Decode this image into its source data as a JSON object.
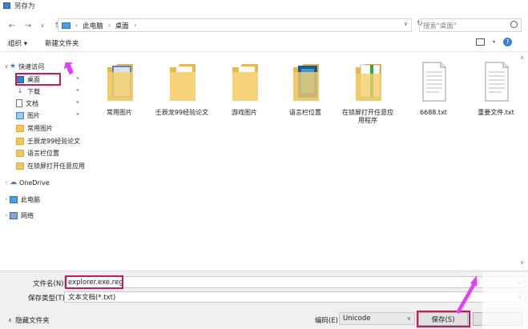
{
  "window": {
    "title": "另存为"
  },
  "nav": {
    "back": "←",
    "forward": "→",
    "up_arrow": "∨",
    "up": "↑"
  },
  "address": {
    "segments": [
      "此电脑",
      "桌面"
    ],
    "separator": "›",
    "dropdown": "∨",
    "refresh": "↻"
  },
  "search": {
    "placeholder": "搜索\"桌面\""
  },
  "toolbar": {
    "organize": "组织 ▾",
    "new_folder": "新建文件夹",
    "help": "?"
  },
  "sidebar": {
    "items": [
      {
        "label": "快速访问",
        "icon": "star-icon",
        "expander": "∨"
      },
      {
        "label": "桌面",
        "icon": "desktop-icon",
        "pinned": true
      },
      {
        "label": "下载",
        "icon": "download-icon",
        "pinned": true
      },
      {
        "label": "文档",
        "icon": "document-icon",
        "pinned": true
      },
      {
        "label": "图片",
        "icon": "pictures-icon",
        "pinned": true
      },
      {
        "label": "常用图片",
        "icon": "folder-icon"
      },
      {
        "label": "壬辰龙99经验论文",
        "icon": "folder-icon"
      },
      {
        "label": "语言栏位置",
        "icon": "folder-icon"
      },
      {
        "label": "在锁屏打开任意应用",
        "icon": "folder-icon"
      },
      {
        "label": "OneDrive",
        "icon": "cloud-icon",
        "expander": "›"
      },
      {
        "label": "此电脑",
        "icon": "computer-icon",
        "expander": "›"
      },
      {
        "label": "网络",
        "icon": "network-icon",
        "expander": "›"
      }
    ],
    "pin_glyph": "✦"
  },
  "files": [
    {
      "label": "常用图片",
      "kind": "folder"
    },
    {
      "label": "壬辰龙99经验论文",
      "kind": "folder"
    },
    {
      "label": "游戏图片",
      "kind": "folder"
    },
    {
      "label": "语言栏位置",
      "kind": "folder"
    },
    {
      "label": "在锁屏打开任意应用程序",
      "kind": "folder"
    },
    {
      "label": "6688.txt",
      "kind": "txt"
    },
    {
      "label": "重要文件.txt",
      "kind": "txt"
    }
  ],
  "form": {
    "filename_label": "文件名(N):",
    "filename_value": "explorer.exe.reg",
    "filetype_label": "保存类型(T):",
    "filetype_value": "文本文档(*.txt)",
    "hide_folders": "隐藏文件夹",
    "hide_caret": "∧",
    "encoding_label": "编码(E):",
    "encoding_value": "Unicode",
    "save_button": "保存(S)",
    "dropdown": "∨"
  },
  "scrollbar": {
    "up": "∧",
    "down": "∨"
  },
  "colors": {
    "highlight": "#d4145a",
    "arrow": "#e040fb",
    "accent": "#3a7fd0",
    "folder": "#f0c85c"
  }
}
